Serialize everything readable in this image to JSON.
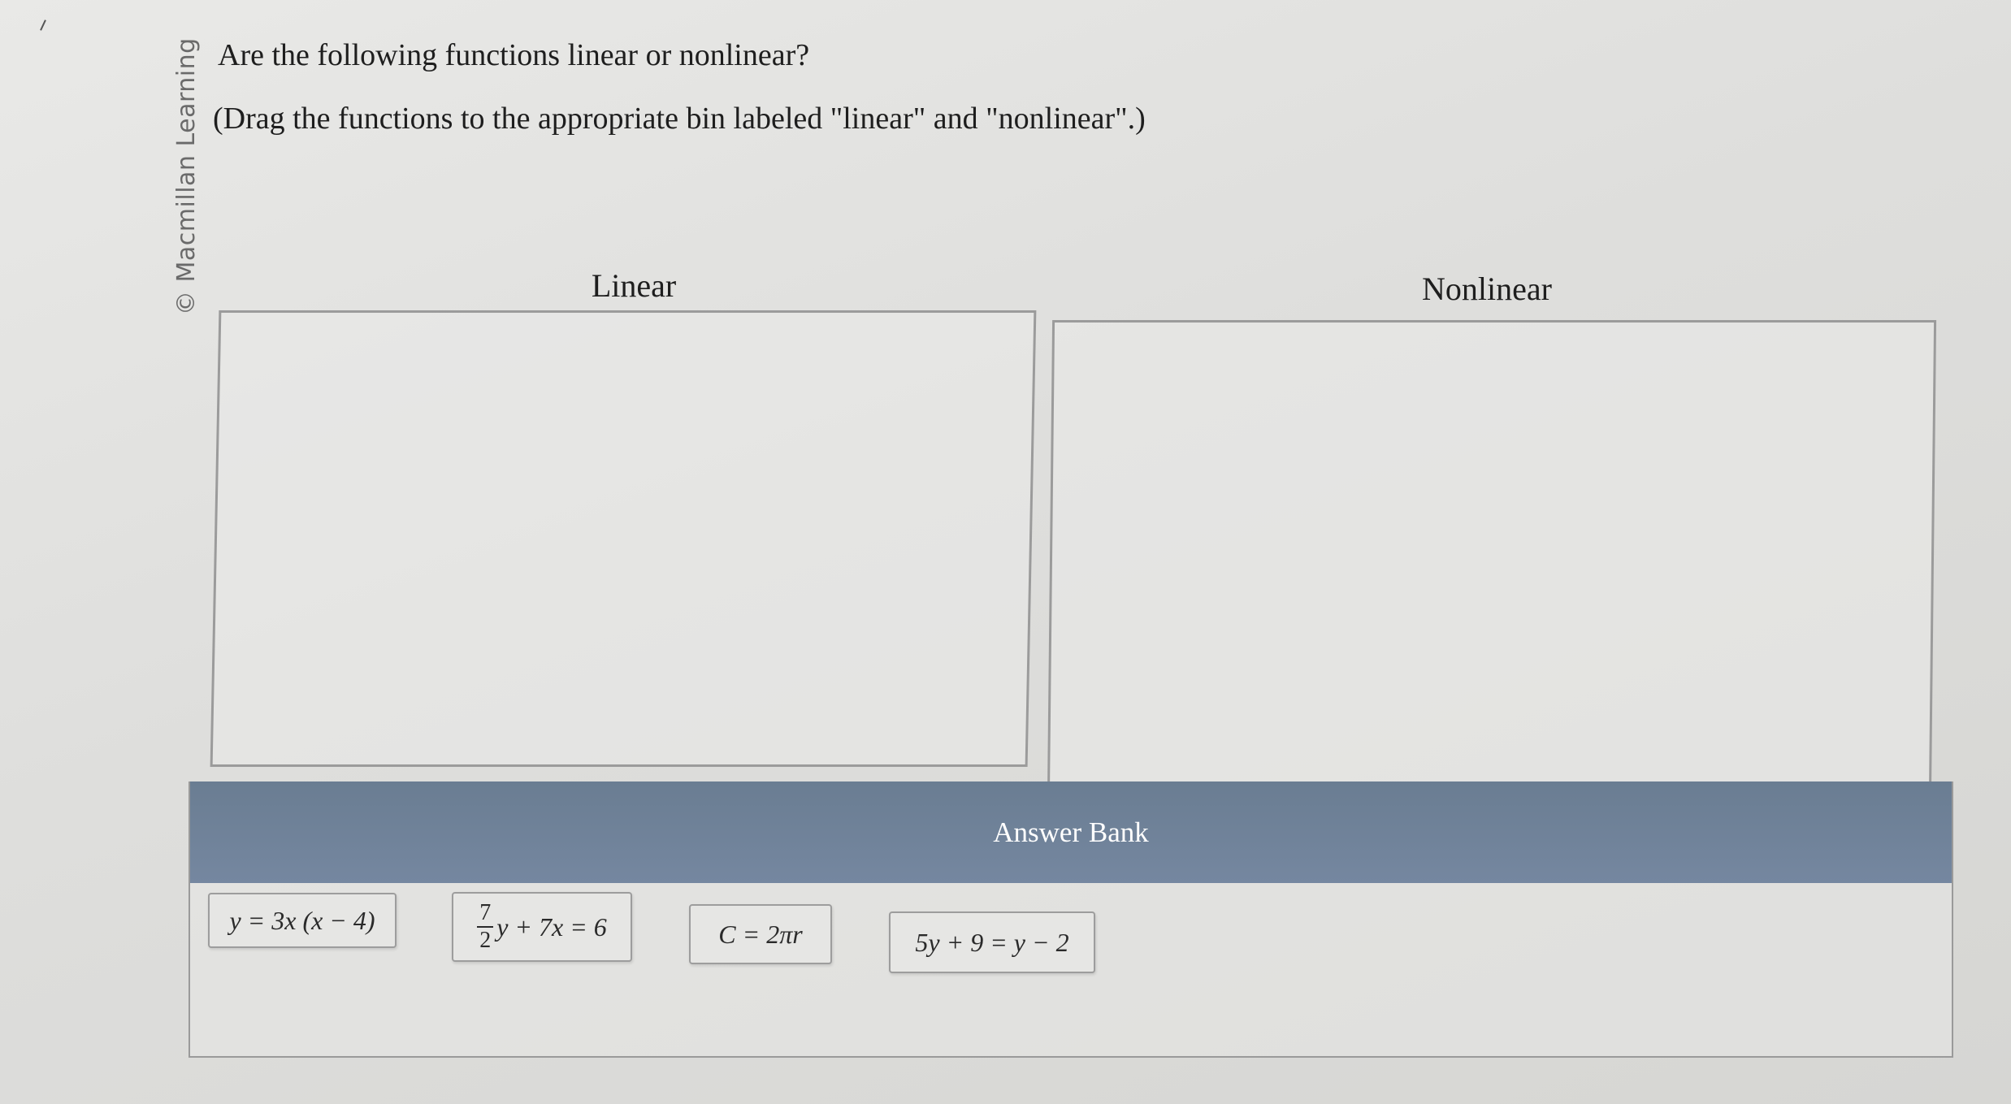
{
  "brand": "© Macmillan Learning",
  "question": "Are the following functions linear or nonlinear?",
  "instruction": "(Drag the functions to the appropriate bin labeled \"linear\" and \"nonlinear\".)",
  "bins": {
    "linear_label": "Linear",
    "nonlinear_label": "Nonlinear"
  },
  "answer_bank": {
    "title": "Answer Bank",
    "items": [
      {
        "text": "y = 3x (x − 4)"
      },
      {
        "numerator": "7",
        "denominator": "2",
        "rest": "y + 7x = 6"
      },
      {
        "text": "C = 2πr"
      },
      {
        "text": "5y + 9 = y − 2"
      }
    ]
  },
  "colors": {
    "bank_header": "#6f8299",
    "bin_border": "#9b9b9b"
  }
}
